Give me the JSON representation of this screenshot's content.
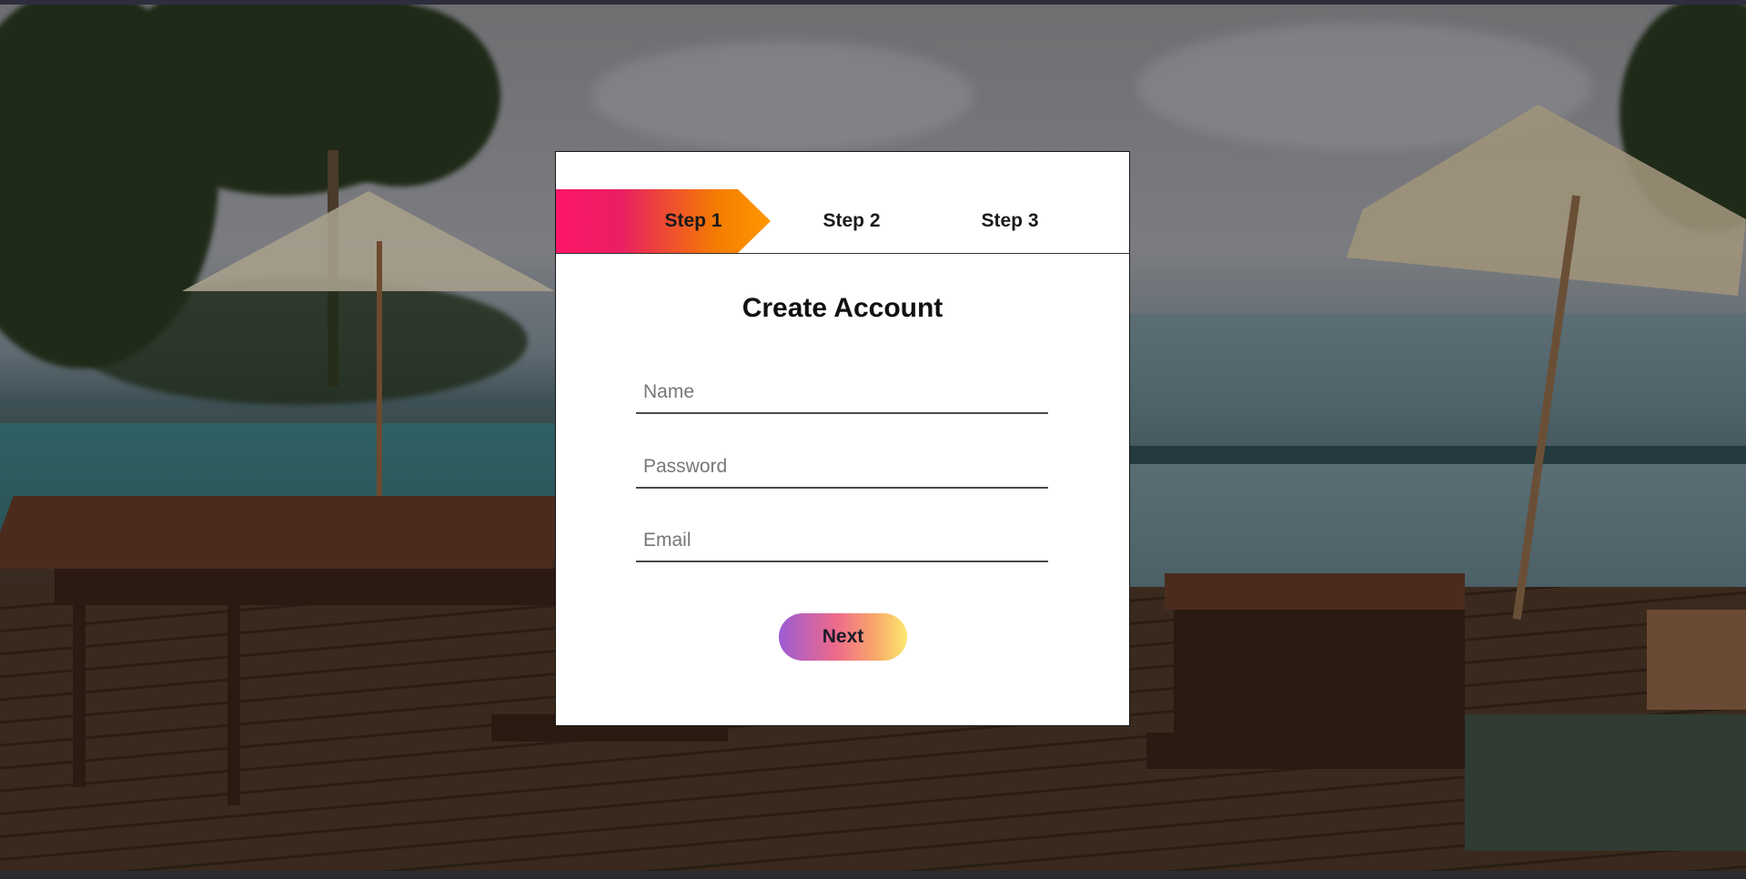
{
  "steps": {
    "items": [
      {
        "label": "Step 1",
        "active": true
      },
      {
        "label": "Step 2",
        "active": false
      },
      {
        "label": "Step 3",
        "active": false
      }
    ]
  },
  "form": {
    "title": "Create Account",
    "name_placeholder": "Name",
    "password_placeholder": "Password",
    "email_placeholder": "Email",
    "next_label": "Next"
  },
  "colors": {
    "active_step_gradient": [
      "#ff1568",
      "#ff9800"
    ],
    "next_button_gradient": [
      "#9c5cd4",
      "#ee6b8a",
      "#fbe86f"
    ],
    "card_background": "#ffffff"
  }
}
